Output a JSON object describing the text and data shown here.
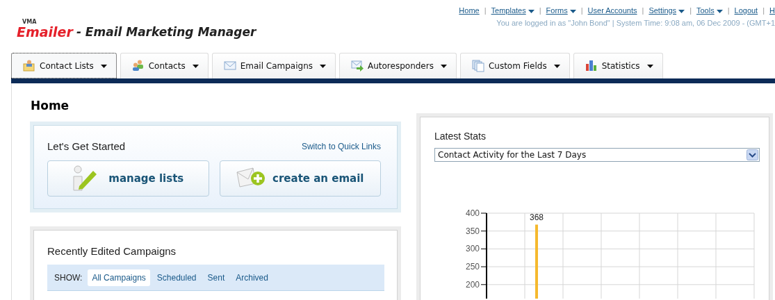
{
  "logo": {
    "badge": "VMA",
    "brand": "Emailer",
    "subtitle": "- Email Marketing Manager"
  },
  "link_separator": "|",
  "top_links": [
    {
      "label": "Home",
      "dropdown": false
    },
    {
      "label": "Templates",
      "dropdown": true
    },
    {
      "label": "Forms",
      "dropdown": true
    },
    {
      "label": "User Accounts",
      "dropdown": false
    },
    {
      "label": "Settings",
      "dropdown": true
    },
    {
      "label": "Tools",
      "dropdown": true
    },
    {
      "label": "Logout",
      "dropdown": false
    },
    {
      "label": "H",
      "dropdown": false
    }
  ],
  "status_line": "You are logged in as \"John Bond\" | System Time: 9:08 am, 06 Dec 2009 - (GMT+1",
  "tabs": [
    {
      "label": "Contact Lists",
      "selected": true
    },
    {
      "label": "Contacts",
      "selected": false
    },
    {
      "label": "Email Campaigns",
      "selected": false
    },
    {
      "label": "Autoresponders",
      "selected": false
    },
    {
      "label": "Custom Fields",
      "selected": false
    },
    {
      "label": "Statistics",
      "selected": false
    }
  ],
  "page_title": "Home",
  "get_started": {
    "title": "Let's Get Started",
    "link": "Switch to Quick Links",
    "buttons": [
      {
        "label": "manage lists"
      },
      {
        "label": "create an email"
      }
    ]
  },
  "recent_campaigns": {
    "title": "Recently Edited Campaigns",
    "show_label": "SHOW:",
    "filters": [
      {
        "label": "All Campaigns",
        "selected": true
      },
      {
        "label": "Scheduled",
        "selected": false
      },
      {
        "label": "Sent",
        "selected": false
      },
      {
        "label": "Archived",
        "selected": false
      }
    ]
  },
  "latest_stats": {
    "title": "Latest Stats",
    "select": {
      "value": "Contact Activity for the Last 7 Days"
    },
    "chart_data": {
      "type": "bar",
      "ylim": [
        160,
        400
      ],
      "yticks": [
        200,
        250,
        300,
        350,
        400
      ],
      "data_labels": true,
      "grid": true,
      "series": [
        {
          "color": "#f5b92e",
          "values": [
            null,
            368,
            null,
            null,
            null,
            null,
            null
          ]
        }
      ]
    }
  }
}
